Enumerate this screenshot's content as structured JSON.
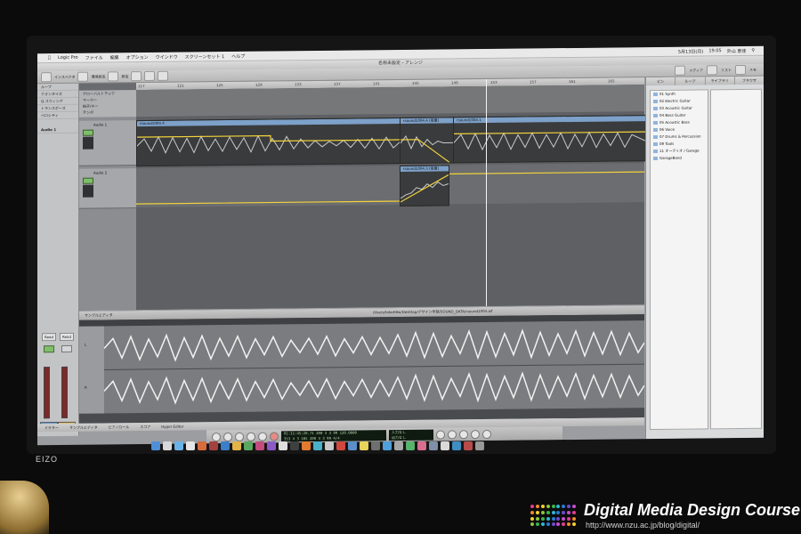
{
  "menubar": {
    "items": [
      "Logic Pro",
      "ファイル",
      "編集",
      "オプション",
      "ウインドウ",
      "スクリーンセット 1",
      "ヘルプ"
    ],
    "status_right": [
      "5月13日(月)",
      "19:05",
      "外山 恵佳"
    ]
  },
  "window": {
    "title": "名称未設定 - アレンジ"
  },
  "toolbar": {
    "left_labels": [
      "インスペクタ",
      "環境設定",
      "設定"
    ],
    "right_labels": [
      "メディア",
      "リスト",
      "メモ"
    ]
  },
  "inspector": {
    "rows": [
      "ループ",
      "クオンタイズ",
      "Q-スウィング",
      "トランスポーズ",
      "ベロシティ"
    ],
    "track_label": "Audio 1",
    "fader_labels": [
      "Read",
      "Read"
    ],
    "bottom_labels": [
      "Audio 1",
      "Output"
    ]
  },
  "arrange": {
    "globals": [
      "グローバルトラック",
      "マーカー",
      "拍子/キー",
      "テンポ"
    ],
    "ruler_ticks": [
      "117",
      "121",
      "125",
      "129",
      "133",
      "137",
      "141",
      "145",
      "149",
      "153",
      "157",
      "161",
      "165"
    ],
    "tracks": [
      {
        "name": "Audio 1",
        "region_top": "rsound1004.4",
        "region_mid": "rsound1004.4 (音量)",
        "region_right": "rsound1004.1"
      },
      {
        "name": "Audio 2",
        "region": "rsound1004.3 (音量)"
      }
    ]
  },
  "editor": {
    "toolbar_label": "サンプルエディタ",
    "path": "/Users/tokaHiko/Desktop/デザイン学部/SOUND_DATA/rsound1004.aif",
    "side_labels": [
      "L",
      "R"
    ]
  },
  "bottombar": {
    "tabs": [
      "ミキサー",
      "サンプルエディタ",
      "ピアノロール",
      "スコア",
      "Hyper Editor"
    ]
  },
  "transport": {
    "lcd_line1": "01:11:45:20.71   200  3  3  99   120.0000",
    "lcd_line2": "353  4  3 185    200  3  3  99   4/4",
    "lcd_side": [
      "入力なし",
      "出力なし"
    ]
  },
  "browser": {
    "tabs": [
      "ビン",
      "ループ",
      "ライブラリ",
      "ブラウザ"
    ],
    "folders": [
      "01 Synth",
      "02 Electric Guitar",
      "03 Acoustic Guitar",
      "04 Bass Guitar",
      "05 Acoustic Bass",
      "06 Voice",
      "07 Drums & Percussion",
      "08 Tools",
      "11 オーディオ / Garage",
      "GarageBand"
    ]
  },
  "monitor": {
    "brand": "EIZO"
  },
  "watermark": {
    "title": "Digital Media Design Course",
    "url": "http://www.nzu.ac.jp/blog/digital/"
  },
  "colors": {
    "region_blue": "#7da1c9",
    "automation_yellow": "#f2d43c",
    "lcd_green": "#b9dcb4"
  }
}
